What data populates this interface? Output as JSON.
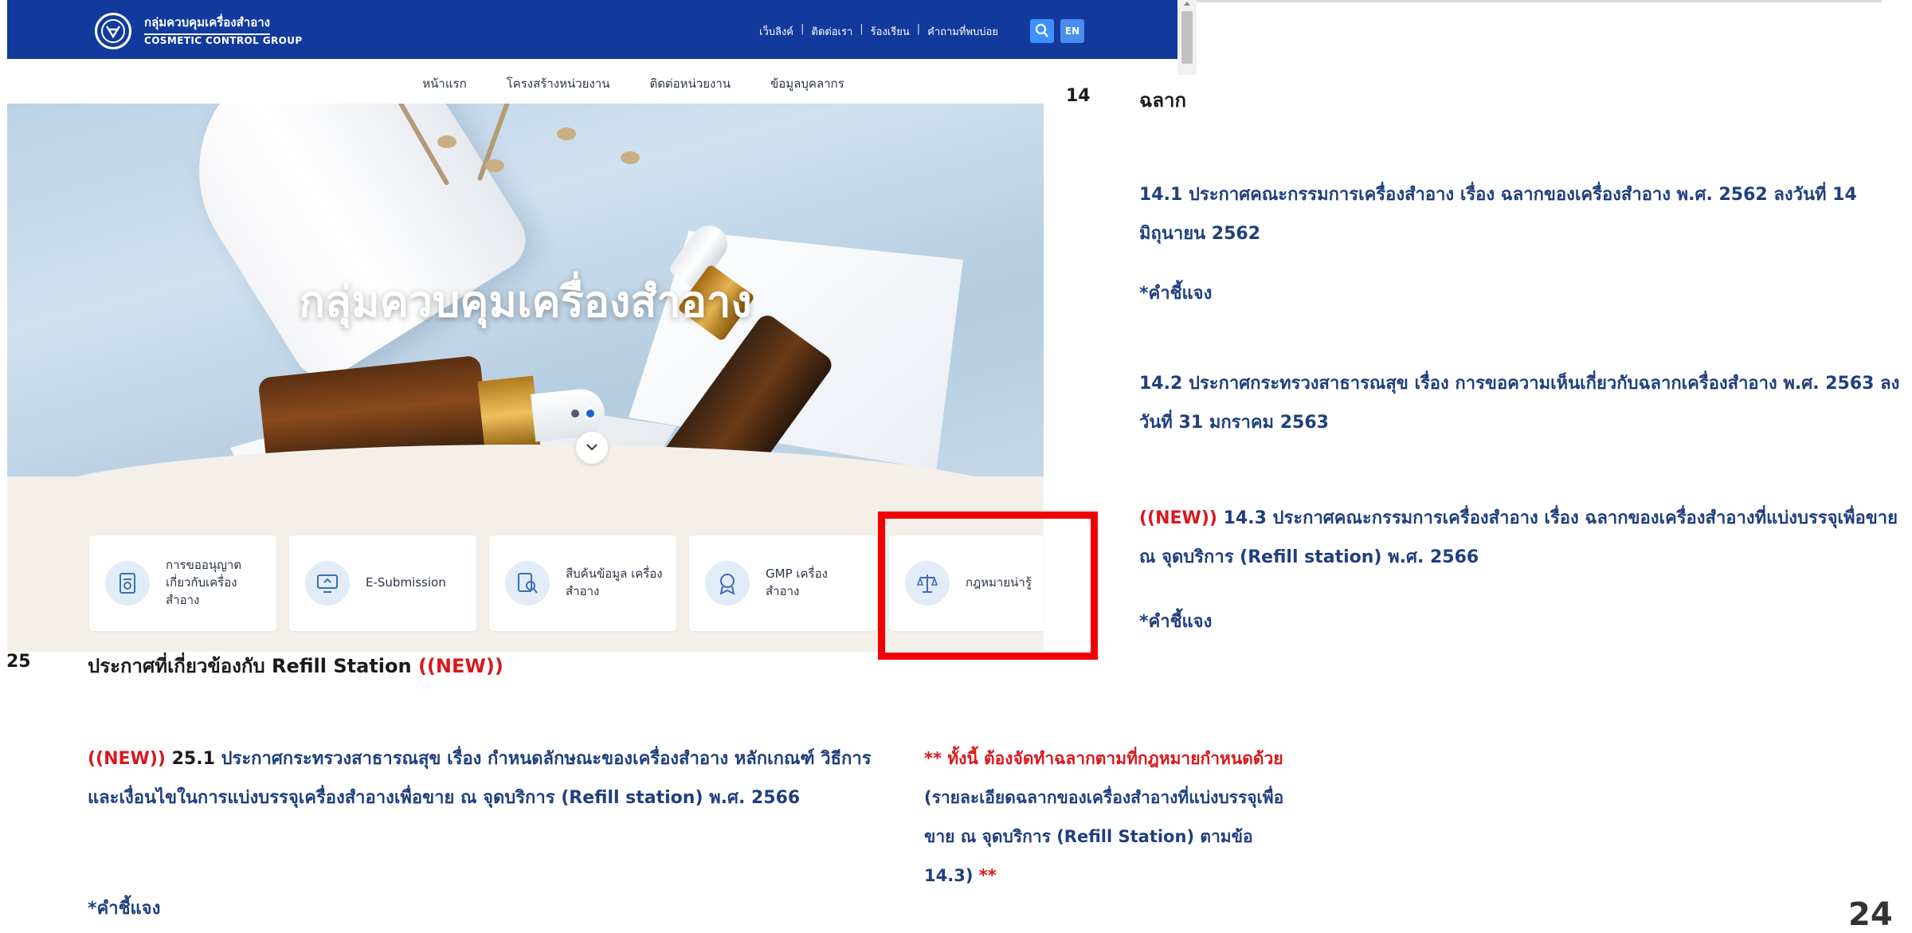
{
  "site": {
    "logo_th": "กลุ่มควบคุมเครื่องสำอาง",
    "logo_en": "COSMETIC CONTROL GROUP",
    "top_links": [
      "เว็บลิงค์",
      "ติดต่อเรา",
      "ร้องเรียน",
      "คำถามที่พบบ่อย"
    ],
    "lang_label": "EN",
    "nav": [
      "หน้าแรก",
      "โครงสร้างหน่วยงาน",
      "ติดต่อหน่วยงาน",
      "ข้อมูลบุคลากร"
    ],
    "hero_title": "กลุ่มควบคุมเครื่องสำอาง",
    "services": [
      {
        "label": "การขออนุญาต เกี่ยวกับเครื่อง สำอาง",
        "icon": "document-license-icon"
      },
      {
        "label": "E-Submission",
        "icon": "computer-upload-icon"
      },
      {
        "label": "สืบค้นข้อมูล เครื่องสำอาง",
        "icon": "search-document-icon"
      },
      {
        "label": "GMP เครื่อง สำอาง",
        "icon": "badge-award-icon"
      },
      {
        "label": "กฎหมายน่ารู้",
        "icon": "law-scale-icon"
      }
    ]
  },
  "doc": {
    "s14": {
      "num": "14",
      "title": "ฉลาก",
      "item1": "14.1 ประกาศคณะกรรมการเครื่องสำอาง เรื่อง ฉลากของเครื่องสำอาง พ.ศ. 2562 ลงวันที่ 14 มิถุนายน 2562",
      "note1": "*คำชี้แจง",
      "item2": "14.2 ประกาศกระทรวงสาธารณสุข เรื่อง การขอความเห็นเกี่ยวกับฉลากเครื่องสำอาง พ.ศ. 2563 ลงวันที่ 31 มกราคม 2563",
      "item3_new": "((NEW))",
      "item3": " 14.3 ประกาศคณะกรรมการเครื่องสำอาง เรื่อง ฉลากของเครื่องสำอางที่แบ่งบรรจุเพื่อขาย ณ จุดบริการ (Refill station) พ.ศ. 2566",
      "note3": "*คำชี้แจง"
    },
    "s25": {
      "num": "25",
      "title": "ประกาศที่เกี่ยวข้องกับ Refill Station ",
      "title_new": "((NEW))",
      "item_new": "((NEW))",
      "item_num": " 25.1",
      "item": " ประกาศกระทรวงสาธารณสุข เรื่อง กำหนดลักษณะของเครื่องสำอาง หลักเกณฑ์ วิธีการ และเงื่อนไขในการแบ่งบรรจุเครื่องสำอางเพื่อขาย ณ จุดบริการ (Refill station) พ.ศ. 2566",
      "note": "*คำชี้แจง",
      "remark_red": "** ทั้งนี้ ต้องจัดทำฉลากตามที่กฎหมายกำหนดด้วย",
      "remark_blue": " (รายละเอียดฉลากของเครื่องสำอางที่แบ่งบรรจุเพื่อขาย ณ จุดบริการ (Refill Station) ตามข้อ 14.3)",
      "remark_end": " **"
    },
    "page_number": "24"
  },
  "colors": {
    "brand_blue": "#123a9d",
    "highlight_red": "#f00000",
    "new_red": "#d9181e",
    "link_blue": "#1f3f7e"
  }
}
